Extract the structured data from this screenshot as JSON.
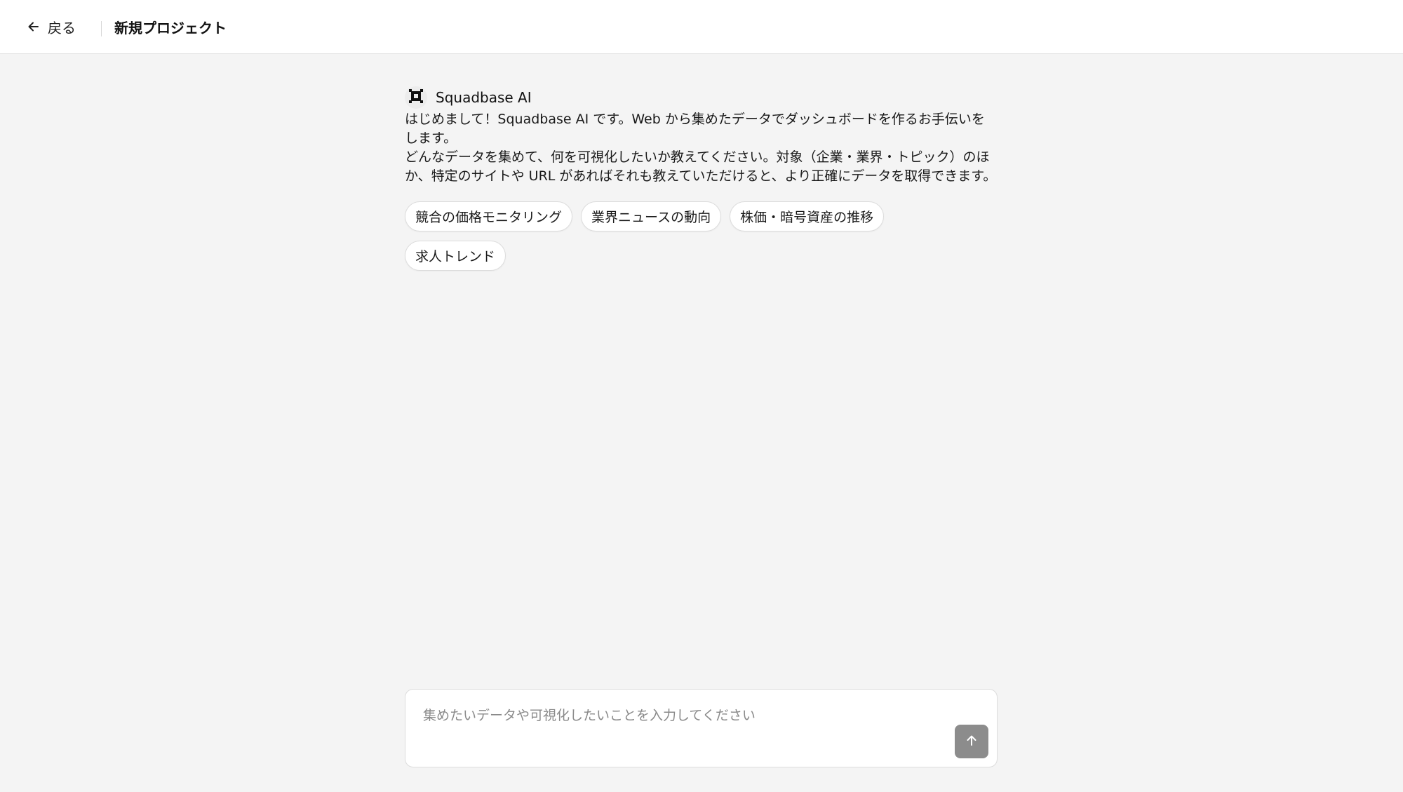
{
  "header": {
    "back_label": "戻る",
    "title": "新規プロジェクト"
  },
  "assistant": {
    "name": "Squadbase AI",
    "avatar_icon": "squadbase-logo-icon",
    "messages": [
      "はじめまして！Squadbase AI です。Web から集めたデータでダッシュボードを作るお手伝いをします。",
      "どんなデータを集めて、何を可視化したいか教えてください。対象（企業・業界・トピック）のほか、特定のサイトや URL があればそれも教えていただけると、より正確にデータを取得できます。"
    ]
  },
  "suggestions": [
    "競合の価格モニタリング",
    "業界ニュースの動向",
    "株価・暗号資産の推移",
    "求人トレンド"
  ],
  "composer": {
    "placeholder": "集めたいデータや可視化したいことを入力してください",
    "value": "",
    "send_icon": "arrow-up-icon"
  },
  "colors": {
    "background": "#f4f4f4",
    "surface": "#ffffff",
    "send_button": "#8c8c8c"
  }
}
